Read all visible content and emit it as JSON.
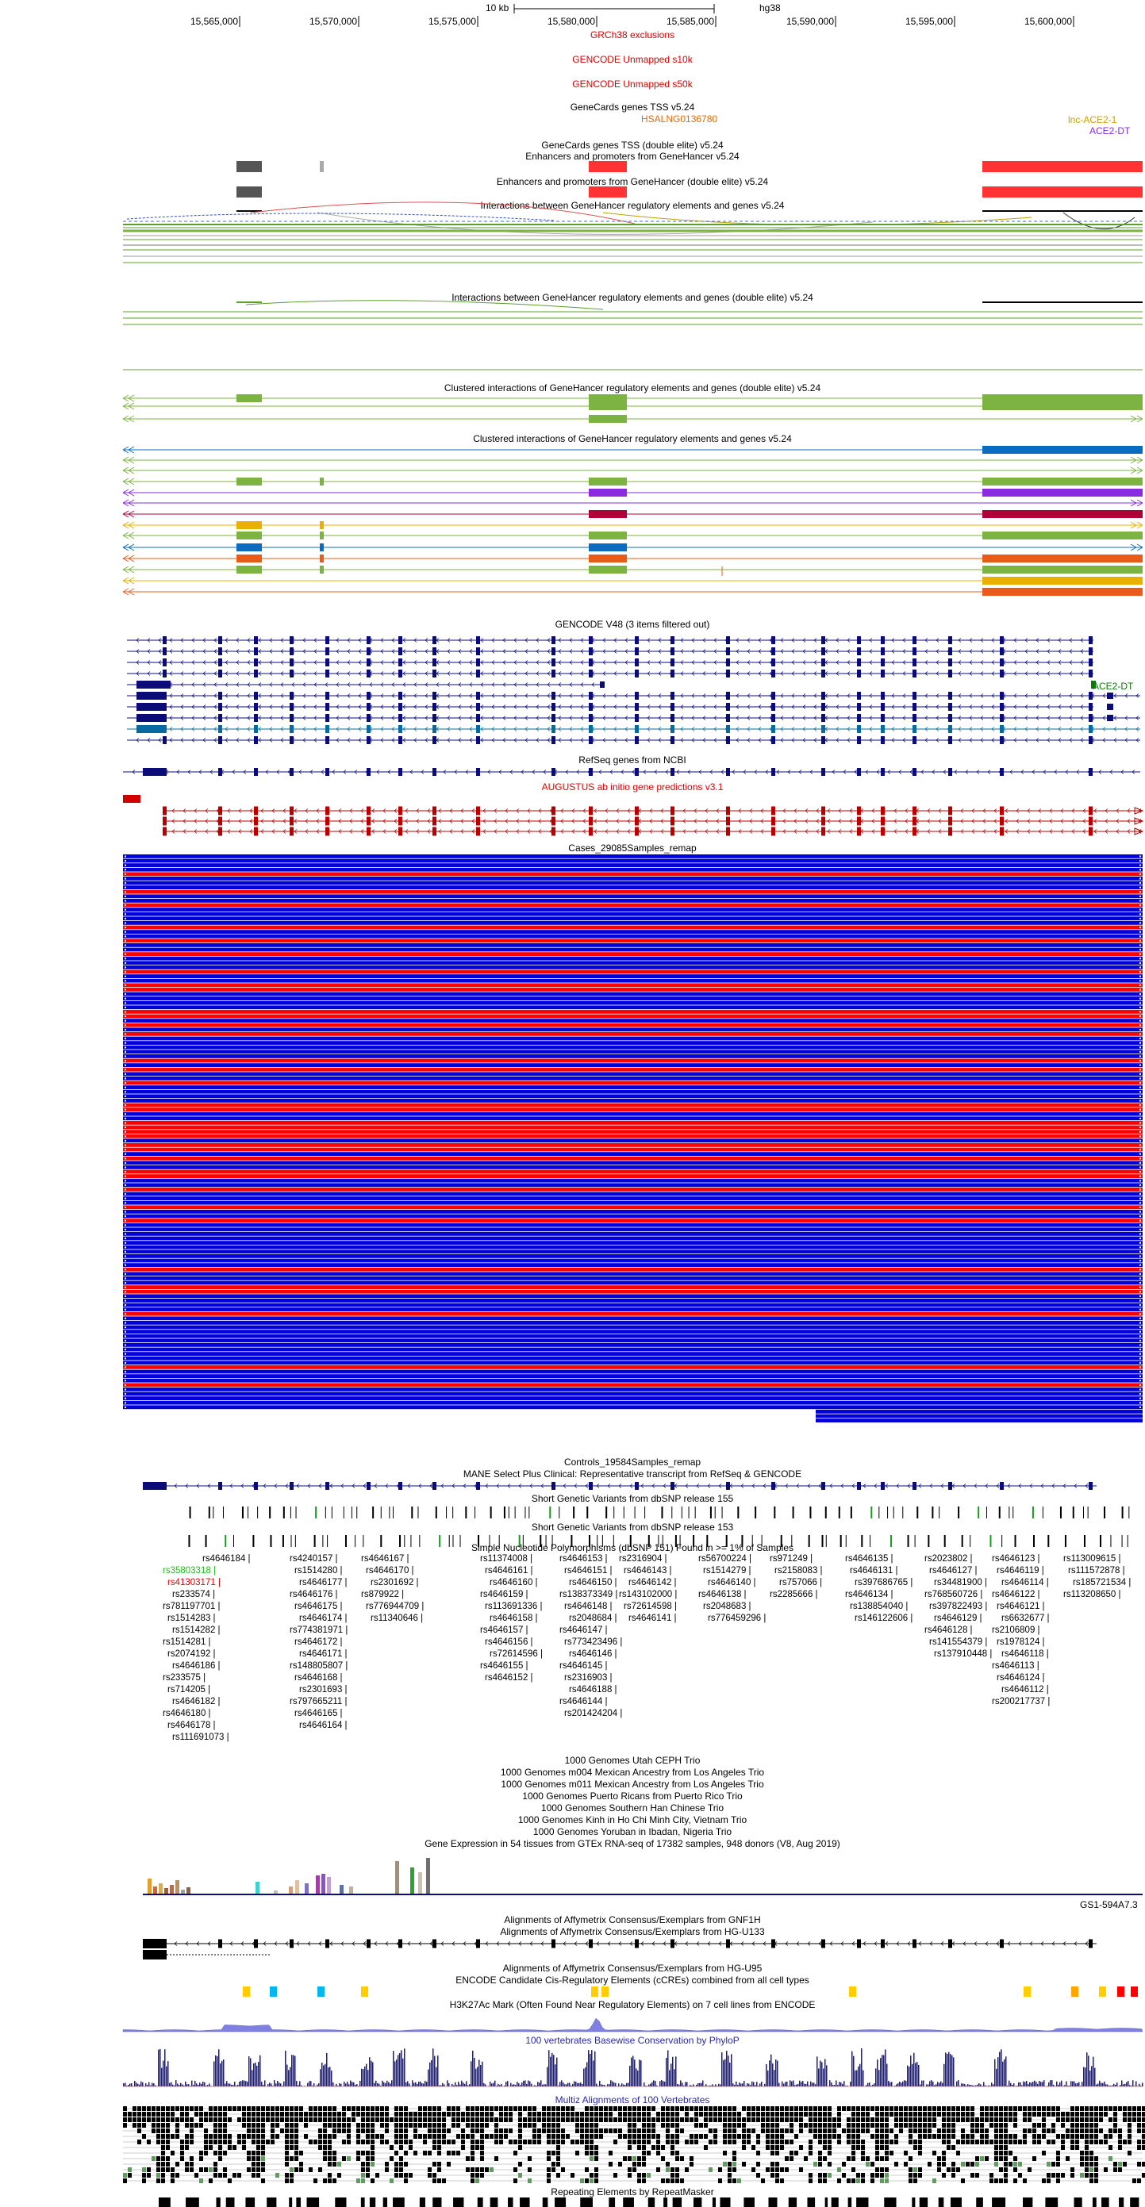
{
  "browser": {
    "assembly": "hg38",
    "scale_label": "10 kb"
  },
  "ruler_ticks": [
    "15,565,000",
    "15,570,000",
    "15,575,000",
    "15,580,000",
    "15,585,000",
    "15,590,000",
    "15,595,000",
    "15,600,000"
  ],
  "track_titles": {
    "grch38_exclusions": "GRCh38 exclusions",
    "gencode_unmapped_10k": "GENCODE Unmapped s10k",
    "gencode_unmapped_50k": "GENCODE Unmapped s50k",
    "genecards_tss": "GeneCards genes TSS v5.24",
    "genecards_tss_de": "GeneCards genes TSS (double elite) v5.24",
    "gh_enhancers": "Enhancers and promoters from GeneHancer v5.24",
    "gh_enhancers_de": "Enhancers and promoters from GeneHancer (double elite) v5.24",
    "gh_interactions": "Interactions between GeneHancer regulatory elements and genes v5.24",
    "gh_interactions_de": "Interactions between GeneHancer regulatory elements and genes (double elite) v5.24",
    "gh_clustered_de": "Clustered interactions of GeneHancer regulatory elements and genes (double elite) v5.24",
    "gh_clustered": "Clustered interactions of GeneHancer regulatory elements and genes v5.24",
    "gencode": "GENCODE V48 (3 items filtered out)",
    "refseq": "RefSeq genes from NCBI",
    "augustus": "AUGUSTUS ab initio gene predictions v3.1",
    "cases": "Cases_29085Samples_remap",
    "controls": "Controls_19584Samples_remap",
    "mane": "MANE Select Plus Clinical: Representative transcript from RefSeq & GENCODE",
    "dbsnp155": "Short Genetic Variants from dbSNP release 155",
    "dbsnp153": "Short Genetic Variants from dbSNP release 153",
    "common_snp": "Simple Nucleotide Polymorphisms (dbSNP 151) Found in >= 1% of Samples",
    "kg_ceph": "1000 Genomes Utah CEPH Trio",
    "kg_m004": "1000 Genomes m004 Mexican Ancestry from Los Angeles Trio",
    "kg_m011": "1000 Genomes m011 Mexican Ancestry from Los Angeles Trio",
    "kg_pr": "1000 Genomes Puerto Ricans from Puerto Rico Trio",
    "kg_chs": "1000 Genomes Southern Han Chinese Trio",
    "kg_kinh": "1000 Genomes Kinh in Ho Chi Minh City, Vietnam Trio",
    "kg_yri": "1000 Genomes Yoruban in Ibadan, Nigeria Trio",
    "gtex": "Gene Expression in 54 tissues from GTEx RNA-seq of 17382 samples, 948 donors (V8, Aug 2019)",
    "gnf1h": "Alignments of Affymetrix Consensus/Exemplars from GNF1H",
    "u133": "Alignments of Affymetrix Consensus/Exemplars from HG-U133",
    "u95": "Alignments of Affymetrix Consensus/Exemplars from HG-U95",
    "encode_ccre": "ENCODE Candidate Cis-Regulatory Elements (cCREs) combined from all cell types",
    "h3k27ac": "H3K27Ac Mark (Often Found Near Regulatory Elements) on 7 cell lines from ENCODE",
    "phylop": "100 vertebrates Basewise Conservation by PhyloP",
    "multiz": "Multiz Alignments of 100 Vertebrates",
    "repeatmasker": "Repeating Elements by RepeatMasker"
  },
  "feature_labels": {
    "hsalng": "HSALNG0136780",
    "lnc_ace2": "lnc-ACE2-1",
    "ace2_dt": "ACE2-DT",
    "ace2_gencode": "ACE2-DT",
    "gs1": "GS1-594A7.3"
  },
  "snp_columns": [
    [
      "rs4646184"
    ],
    [
      "rs35803318",
      "rs41303171",
      "rs233574",
      "rs781197701",
      "rs1514283",
      "rs1514282",
      "rs1514281",
      "rs2074192",
      "rs4646186",
      "rs233575",
      "rs714205",
      "rs4646182",
      "rs4646180",
      "rs4646178",
      "rs111691073"
    ],
    [
      "rs4240157",
      "rs1514280",
      "rs4646177",
      "rs4646176",
      "rs4646175",
      "rs4646174",
      "rs774381971",
      "rs4646172",
      "rs4646171",
      "rs148805807",
      "rs4646168",
      "rs2301693",
      "rs797665211",
      "rs4646165",
      "rs4646164"
    ],
    [
      "rs4646167",
      "rs4646170",
      "rs2301692",
      "rs879922",
      "rs776944709",
      "rs11340646"
    ],
    [
      "rs11374008",
      "rs4646161",
      "rs4646160",
      "rs4646159",
      "rs113691336",
      "rs4646158",
      "rs4646157",
      "rs4646156",
      "rs72614596",
      "rs4646155",
      "rs4646152"
    ],
    [
      "rs4646153",
      "rs4646151",
      "rs4646150",
      "rs138373349",
      "rs4646148",
      "rs2048684",
      "rs4646147",
      "rs773423496",
      "rs4646146",
      "rs4646145",
      "rs2316903",
      "rs4646188",
      "rs4646144",
      "rs201424204"
    ],
    [
      "rs2316904",
      "rs4646143",
      "rs4646142",
      "rs143102000",
      "rs72614598",
      "rs4646141"
    ],
    [
      "rs56700224",
      "rs1514279",
      "rs4646140",
      "rs4646138",
      "rs2048683",
      "rs776459296"
    ],
    [
      "rs971249",
      "rs2158083",
      "rs757066",
      "rs2285666"
    ],
    [
      "rs4646135",
      "rs4646131",
      "rs397686765",
      "rs4646134",
      "rs138854040",
      "rs146122606"
    ],
    [
      "rs2023802",
      "rs4646127",
      "rs34481900",
      "rs768560726",
      "rs397822493",
      "rs4646129",
      "rs4646128",
      "rs141554379",
      "rs137910448"
    ],
    [
      "rs4646123",
      "rs4646119",
      "rs4646114",
      "rs4646122",
      "rs4646121",
      "rs6632677",
      "rs2106809",
      "rs1978124",
      "rs4646118",
      "rs4646113",
      "rs4646124",
      "rs4646112",
      "rs200217737"
    ],
    [
      "rs113009615",
      "rs111572878",
      "rs185721534",
      "rs113208650"
    ]
  ],
  "colors": {
    "exclusion_red": "#e00000",
    "enhancer_red": "#ff3333",
    "gencode_navy": "#0c0c78",
    "augustus_red": "#b80000",
    "case_red": "#ff0000",
    "case_blue": "#0000dd",
    "refseq_navy": "#0c0c78",
    "phylop_blue": "#1a1a96",
    "ccre_yellow": "#ffcd00",
    "ccre_red": "#ff0000",
    "ccre_cyan": "#06b6ee"
  }
}
